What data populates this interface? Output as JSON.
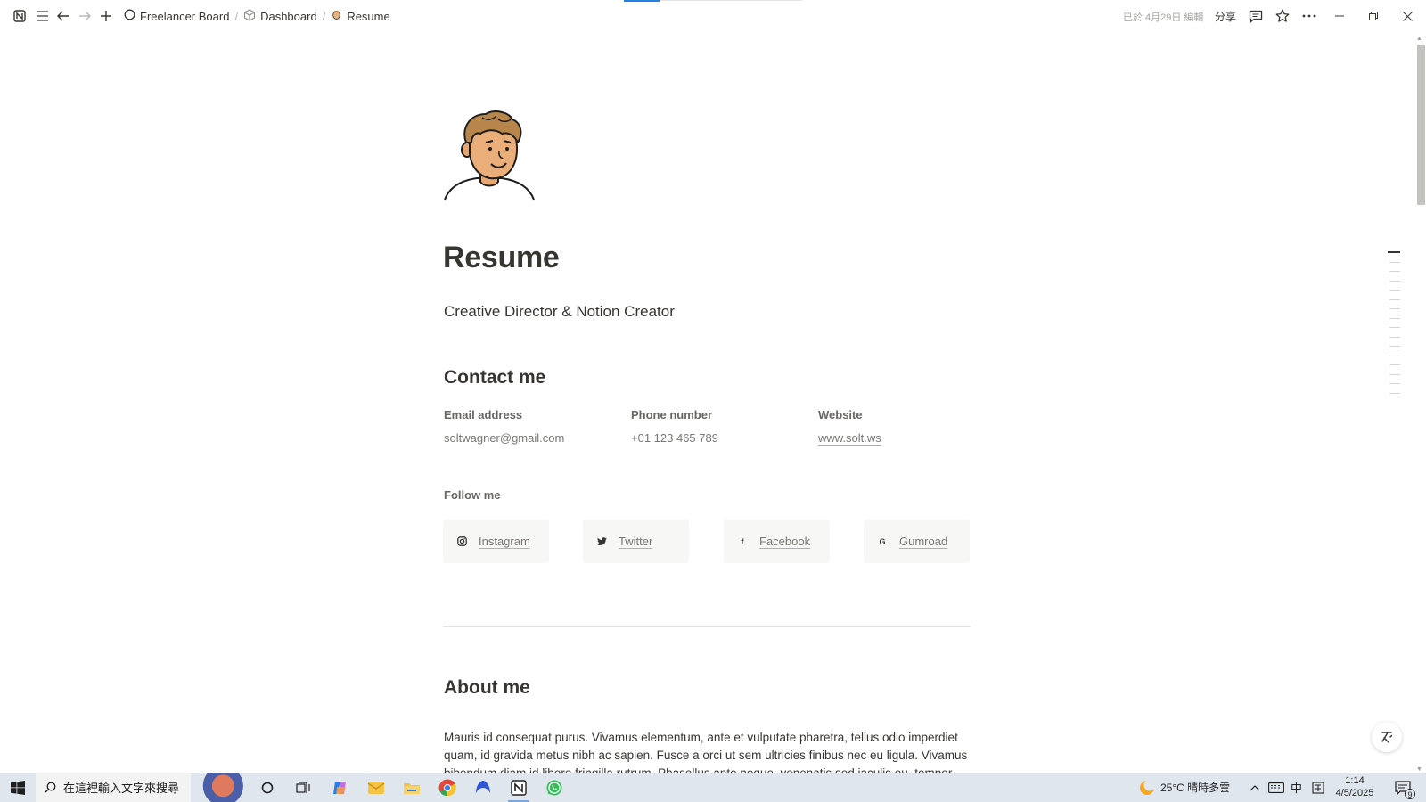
{
  "topbar": {
    "breadcrumbs": [
      {
        "label": "Freelancer Board",
        "icon": "circle-icon"
      },
      {
        "label": "Dashboard",
        "icon": "cube-icon"
      },
      {
        "label": "Resume",
        "icon": "avatar-icon"
      }
    ],
    "edited": "已於 4月29日 編輯",
    "share": "分享"
  },
  "page": {
    "title": "Resume",
    "subtitle": "Creative Director & Notion Creator",
    "contact_heading": "Contact me",
    "contact": [
      {
        "label": "Email address",
        "value": "soltwagner@gmail.com"
      },
      {
        "label": "Phone number",
        "value": "+01 123 465 789"
      },
      {
        "label": "Website",
        "value": "www.solt.ws"
      }
    ],
    "follow_label": "Follow me",
    "socials": [
      {
        "label": "Instagram",
        "icon": "instagram-icon",
        "glyph": "◎"
      },
      {
        "label": "Twitter",
        "icon": "twitter-icon",
        "glyph": "🐦"
      },
      {
        "label": "Facebook",
        "icon": "facebook-icon",
        "glyph": "f"
      },
      {
        "label": "Gumroad",
        "icon": "gumroad-icon",
        "glyph": "G"
      }
    ],
    "about_heading": "About me",
    "about_text": "Mauris id consequat purus. Vivamus elementum, ante et vulputate pharetra, tellus odio imperdiet quam, id gravida metus nibh ac sapien. Fusce a orci ut sem ultricies finibus nec eu ligula. Vivamus bibendum diam id libero fringilla rutrum. Phasellus ante neque, venenatis sed iaculis eu, tempor vel"
  },
  "taskbar": {
    "search_placeholder": "在這裡輸入文字來搜尋",
    "weather": "25°C  晴時多雲",
    "ime": "中",
    "time": "1:14",
    "date": "4/5/2025",
    "notifications": "9"
  },
  "colors": {
    "text": "#37352f",
    "muted": "#787774",
    "accent": "#2383e2",
    "taskbar": "#dfe6ee"
  }
}
